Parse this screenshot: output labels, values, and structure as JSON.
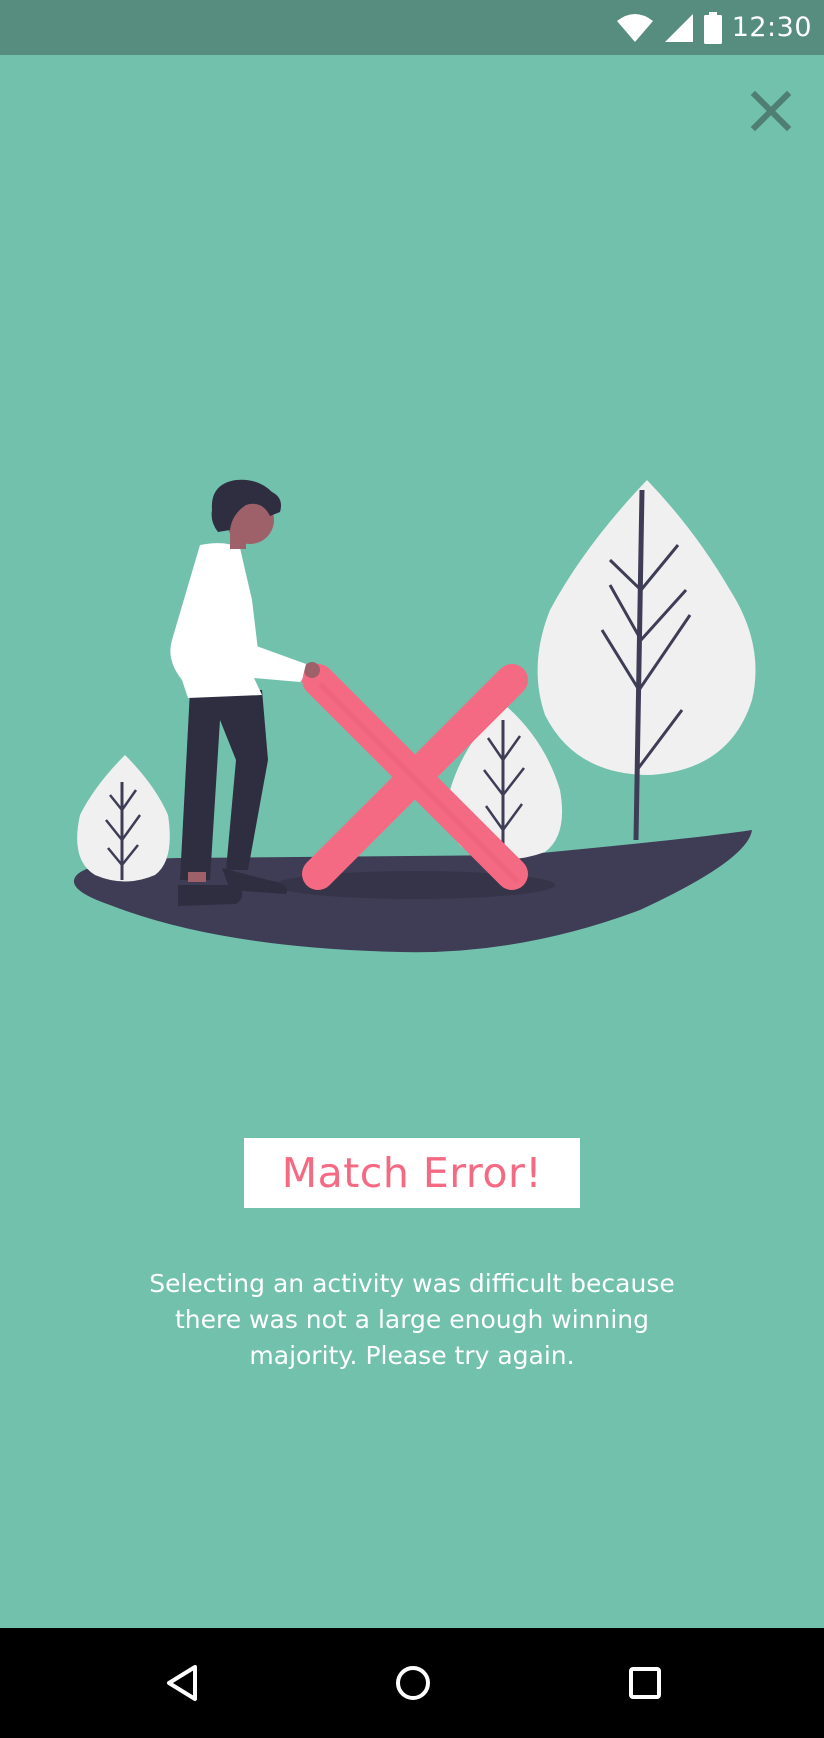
{
  "status_bar": {
    "time": "12:30",
    "icons": [
      "wifi-icon",
      "signal-icon",
      "battery-icon"
    ]
  },
  "dialog": {
    "close_icon": "close-icon",
    "title": "Match Error!",
    "message": "Selecting an activity was difficult because there was not a large enough winning majority. Please try again."
  },
  "nav_bar": {
    "icons": [
      "back-icon",
      "home-icon",
      "recents-icon"
    ]
  },
  "colors": {
    "background": "#72c1ad",
    "status_bar": "#578d7f",
    "accent": "#f56a83",
    "ground": "#3f3d56",
    "leaf": "#f0f0f0"
  }
}
